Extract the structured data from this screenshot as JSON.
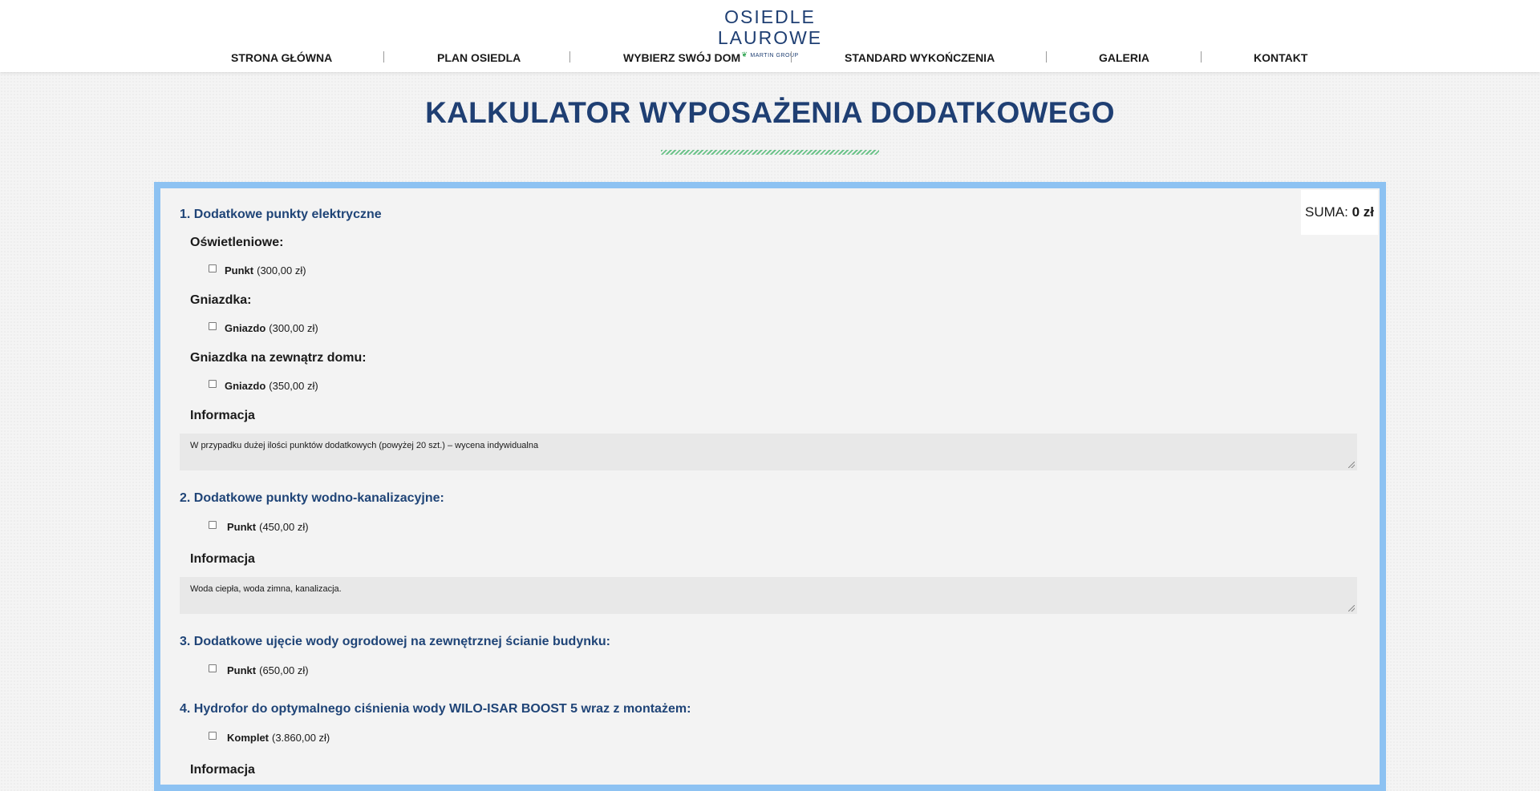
{
  "header": {
    "logo_main": "OSIEDLE LAUROWE",
    "logo_sub": "MARTIN GROUP",
    "nav": [
      {
        "label": "STRONA GŁÓWNA"
      },
      {
        "label": "PLAN OSIEDLA"
      },
      {
        "label": "WYBIERZ SWÓJ DOM"
      },
      {
        "label": "STANDARD WYKOŃCZENIA"
      },
      {
        "label": "GALERIA"
      },
      {
        "label": "KONTAKT"
      }
    ]
  },
  "page": {
    "title": "KALKULATOR WYPOSAŻENIA DODATKOWEGO"
  },
  "sum": {
    "label": "SUMA:",
    "value": "0 zł"
  },
  "sections": {
    "s1": {
      "title": "1. Dodatkowe punkty elektryczne",
      "groups": [
        {
          "title": "Oświetleniowe:",
          "option": {
            "name": "Punkt",
            "price": "(300,00 zł)"
          }
        },
        {
          "title": "Gniazdka:",
          "option": {
            "name": "Gniazdo",
            "price": "(300,00 zł)"
          }
        },
        {
          "title": "Gniazdka na zewnątrz domu:",
          "option": {
            "name": "Gniazdo",
            "price": "(350,00 zł)"
          }
        }
      ],
      "info_title": "Informacja",
      "info_text": "W przypadku dużej ilości punktów dodatkowych (powyżej 20 szt.) – wycena indywidualna"
    },
    "s2": {
      "title": "2. Dodatkowe punkty wodno-kanalizacyjne:",
      "option": {
        "name": "Punkt",
        "price": "(450,00 zł)"
      },
      "info_title": "Informacja",
      "info_text": "Woda ciepła, woda zimna, kanalizacja."
    },
    "s3": {
      "title": "3. Dodatkowe ujęcie wody ogrodowej na zewnętrznej ścianie budynku:",
      "option": {
        "name": "Punkt",
        "price": "(650,00 zł)"
      }
    },
    "s4": {
      "title": "4. Hydrofor do optymalnego ciśnienia wody WILO-ISAR BOOST 5 wraz z montażem:",
      "option": {
        "name": "Komplet",
        "price": "(3.860,00 zł)"
      },
      "info_title": "Informacja"
    }
  },
  "colors": {
    "brand_blue": "#1f3f73",
    "section_blue": "#1f4477",
    "panel_border": "#8dc2f2",
    "accent_green": "#6cc38a"
  }
}
